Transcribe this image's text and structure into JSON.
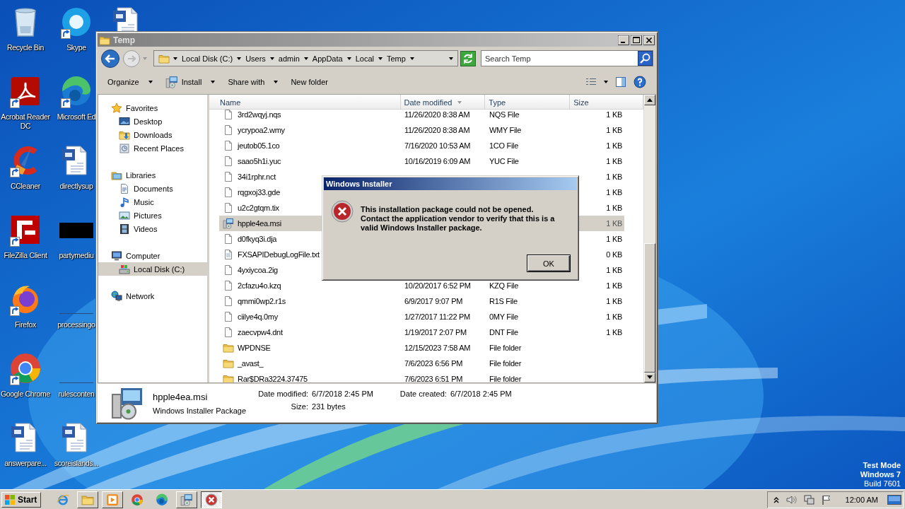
{
  "desktop": {
    "icons": [
      {
        "label": "Recycle Bin",
        "kind": "recycle",
        "shortcut": false
      },
      {
        "label": "Acrobat Reader DC",
        "kind": "pdf",
        "shortcut": true
      },
      {
        "label": "CCleaner",
        "kind": "cleaner",
        "shortcut": true
      },
      {
        "label": "FileZilla Client",
        "kind": "ftp",
        "shortcut": true
      },
      {
        "label": "Firefox",
        "kind": "firefox",
        "shortcut": true
      },
      {
        "label": "Google Chrome",
        "kind": "chrome",
        "shortcut": true
      },
      {
        "label": "answerpare...",
        "kind": "word",
        "shortcut": false
      },
      {
        "label": "Skype",
        "kind": "skype",
        "shortcut": true
      },
      {
        "label": "Microsoft Ed",
        "kind": "edge",
        "shortcut": true
      },
      {
        "label": "directlysup",
        "kind": "word",
        "shortcut": false
      },
      {
        "label": "partymediu",
        "kind": "dark",
        "shortcut": false
      },
      {
        "label": "processingo",
        "kind": "blank",
        "shortcut": false
      },
      {
        "label": "rulesconten",
        "kind": "blank",
        "shortcut": false
      },
      {
        "label": "scoreislands...",
        "kind": "word",
        "shortcut": false
      },
      {
        "kind": "word",
        "shortcut": false
      }
    ]
  },
  "explorer": {
    "title": "Temp",
    "address": {
      "crumbs": [
        "Local Disk (C:)",
        "Users",
        "admin",
        "AppData",
        "Local",
        "Temp"
      ]
    },
    "search": {
      "placeholder": "Search Temp"
    },
    "toolbar": [
      {
        "label": "Organize",
        "kind": "menu"
      },
      {
        "label": "Install",
        "kind": "icon-menu"
      },
      {
        "label": "Share with",
        "kind": "menu"
      },
      {
        "label": "New folder",
        "kind": "button"
      }
    ],
    "nav": [
      {
        "label": "Favorites",
        "kind": "star",
        "selected": false,
        "children": [
          {
            "label": "Desktop",
            "kind": "desktop",
            "selected": false
          },
          {
            "label": "Downloads",
            "kind": "downloads",
            "selected": false
          },
          {
            "label": "Recent Places",
            "kind": "recent",
            "selected": false
          }
        ]
      },
      {
        "label": "Libraries",
        "kind": "library",
        "selected": false,
        "children": [
          {
            "label": "Documents",
            "kind": "document",
            "selected": false
          },
          {
            "label": "Music",
            "kind": "music",
            "selected": false
          },
          {
            "label": "Pictures",
            "kind": "pictures",
            "selected": false
          },
          {
            "label": "Videos",
            "kind": "videos",
            "selected": false
          }
        ]
      },
      {
        "label": "Computer",
        "kind": "computer",
        "selected": false,
        "children": [
          {
            "label": "Local Disk (C:)",
            "kind": "disk",
            "selected": true
          }
        ]
      },
      {
        "label": "Network",
        "kind": "network",
        "selected": false
      }
    ],
    "columns": [
      {
        "label": "Name",
        "sorted": false
      },
      {
        "label": "Date modified",
        "sorted": true
      },
      {
        "label": "Type",
        "sorted": false
      },
      {
        "label": "Size",
        "sorted": false
      }
    ],
    "files": [
      {
        "name": "3rd2wqyj.nqs",
        "date": "11/26/2020 8:38 AM",
        "type": "NQS File",
        "size": "1 KB",
        "kind": "file",
        "selected": false
      },
      {
        "name": "ycrypoa2.wmy",
        "date": "11/26/2020 8:38 AM",
        "type": "WMY File",
        "size": "1 KB",
        "kind": "file",
        "selected": false
      },
      {
        "name": "jeutob05.1co",
        "date": "7/16/2020 10:53 AM",
        "type": "1CO File",
        "size": "1 KB",
        "kind": "file",
        "selected": false
      },
      {
        "name": "saao5h1i.yuc",
        "date": "10/16/2019 6:09 AM",
        "type": "YUC File",
        "size": "1 KB",
        "kind": "file",
        "selected": false
      },
      {
        "name": "34i1rphr.nct",
        "size": "1 KB",
        "kind": "file",
        "selected": false
      },
      {
        "name": "rqgxoj33.gde",
        "size": "1 KB",
        "kind": "file",
        "selected": false
      },
      {
        "name": "u2c2gtqm.tix",
        "size": "1 KB",
        "kind": "file",
        "selected": false
      },
      {
        "name": "hpple4ea.msi",
        "size": "1 KB",
        "kind": "msi",
        "selected": true
      },
      {
        "name": "d0fkyq3i.dja",
        "size": "1 KB",
        "kind": "file",
        "selected": false
      },
      {
        "name": "FXSAPIDebugLogFile.txt",
        "size": "0 KB",
        "kind": "text",
        "selected": false
      },
      {
        "name": "4yxiycoa.2ig",
        "size": "1 KB",
        "kind": "file",
        "selected": false
      },
      {
        "name": "2cfazu4o.kzq",
        "date": "10/20/2017 6:52 PM",
        "type": "KZQ File",
        "size": "1 KB",
        "kind": "file",
        "selected": false
      },
      {
        "name": "qmmi0wp2.r1s",
        "date": "6/9/2017 9:07 PM",
        "type": "R1S File",
        "size": "1 KB",
        "kind": "file",
        "selected": false
      },
      {
        "name": "ciilye4q.0my",
        "date": "1/27/2017 11:22 PM",
        "type": "0MY File",
        "size": "1 KB",
        "kind": "file",
        "selected": false
      },
      {
        "name": "zaecvpw4.dnt",
        "date": "1/19/2017 2:07 PM",
        "type": "DNT File",
        "size": "1 KB",
        "kind": "file",
        "selected": false
      },
      {
        "name": "WPDNSE",
        "date": "12/15/2023 7:58 AM",
        "type": "File folder",
        "kind": "folder",
        "selected": false
      },
      {
        "name": "_avast_",
        "date": "7/6/2023 6:56 PM",
        "type": "File folder",
        "kind": "folder",
        "selected": false
      },
      {
        "name": "Rar$DRa3224.37475",
        "date": "7/6/2023 6:51 PM",
        "type": "File folder",
        "kind": "folder",
        "selected": false
      }
    ],
    "details": {
      "name": "hpple4ea.msi",
      "type": "Windows Installer Package",
      "fields": [
        {
          "label": "Date modified:",
          "value": "6/7/2018 2:45 PM"
        },
        {
          "label": "Size:",
          "value": "231 bytes"
        },
        {
          "label": "Date created:",
          "value": "6/7/2018 2:45 PM"
        }
      ]
    }
  },
  "dialog": {
    "title": "Windows Installer",
    "message": [
      "This installation package could not be opened.",
      "Contact the application vendor to verify that this is a valid Windows Installer package."
    ],
    "buttons": [
      {
        "label": "OK",
        "default": true
      }
    ]
  },
  "os_notice": [
    {
      "text": "Test Mode",
      "bold": true
    },
    {
      "text": "Windows 7",
      "bold": true
    },
    {
      "text": "Build 7601",
      "bold": false
    }
  ],
  "taskbar": {
    "start": "Start",
    "items": [
      {
        "kind": "ie",
        "open": false,
        "active": false
      },
      {
        "kind": "explorer",
        "open": true,
        "active": false
      },
      {
        "kind": "media",
        "open": true,
        "active": false
      },
      {
        "kind": "chrome",
        "open": false,
        "active": false
      },
      {
        "kind": "edge",
        "open": false,
        "active": false
      },
      {
        "kind": "msi",
        "open": true,
        "active": false
      },
      {
        "kind": "error",
        "open": true,
        "active": true
      }
    ],
    "clock": "12:00 AM"
  }
}
